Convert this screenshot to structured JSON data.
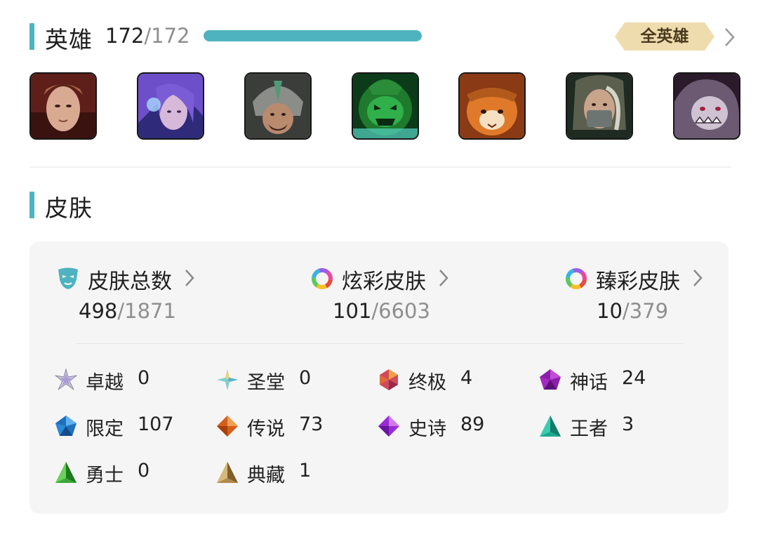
{
  "champions": {
    "title": "英雄",
    "owned": "172",
    "separator": "/",
    "total": "172",
    "progress": 1.0,
    "all_button_label": "全英雄",
    "portraits": [
      {
        "name": "champion-portrait-1",
        "icon": "champion-portrait"
      },
      {
        "name": "champion-portrait-2",
        "icon": "champion-portrait"
      },
      {
        "name": "champion-portrait-3",
        "icon": "champion-portrait"
      },
      {
        "name": "champion-portrait-4",
        "icon": "champion-portrait"
      },
      {
        "name": "champion-portrait-5",
        "icon": "champion-portrait"
      },
      {
        "name": "champion-portrait-6",
        "icon": "champion-portrait"
      },
      {
        "name": "champion-portrait-7",
        "icon": "champion-portrait"
      }
    ]
  },
  "skins": {
    "title": "皮肤",
    "stats": [
      {
        "label": "皮肤总数",
        "icon": "mask-icon",
        "owned": "498",
        "separator": "/",
        "total": "1871"
      },
      {
        "label": "炫彩皮肤",
        "icon": "chroma-ring-icon",
        "owned": "101",
        "separator": "/",
        "total": "6603"
      },
      {
        "label": "臻彩皮肤",
        "icon": "prestige-ring-icon",
        "owned": "10",
        "separator": "/",
        "total": "379"
      }
    ],
    "rarities": [
      {
        "name": "卓越",
        "value": "0",
        "icon": "transcendent-gem-icon"
      },
      {
        "name": "圣堂",
        "value": "0",
        "icon": "exalted-gem-icon"
      },
      {
        "name": "终极",
        "value": "4",
        "icon": "ultimate-gem-icon"
      },
      {
        "name": "神话",
        "value": "24",
        "icon": "mythic-gem-icon"
      },
      {
        "name": "限定",
        "value": "107",
        "icon": "limited-gem-icon"
      },
      {
        "name": "传说",
        "value": "73",
        "icon": "legendary-gem-icon"
      },
      {
        "name": "史诗",
        "value": "89",
        "icon": "epic-gem-icon"
      },
      {
        "name": "王者",
        "value": "3",
        "icon": "champion-gem-icon"
      },
      {
        "name": "勇士",
        "value": "0",
        "icon": "warrior-gem-icon"
      },
      {
        "name": "典藏",
        "value": "1",
        "icon": "collection-gem-icon"
      }
    ]
  },
  "colors": {
    "accent": "#4fb3bf",
    "badge_gold": "#efdcae",
    "panel_bg": "#f5f5f5",
    "muted_text": "#8f8f8f"
  }
}
